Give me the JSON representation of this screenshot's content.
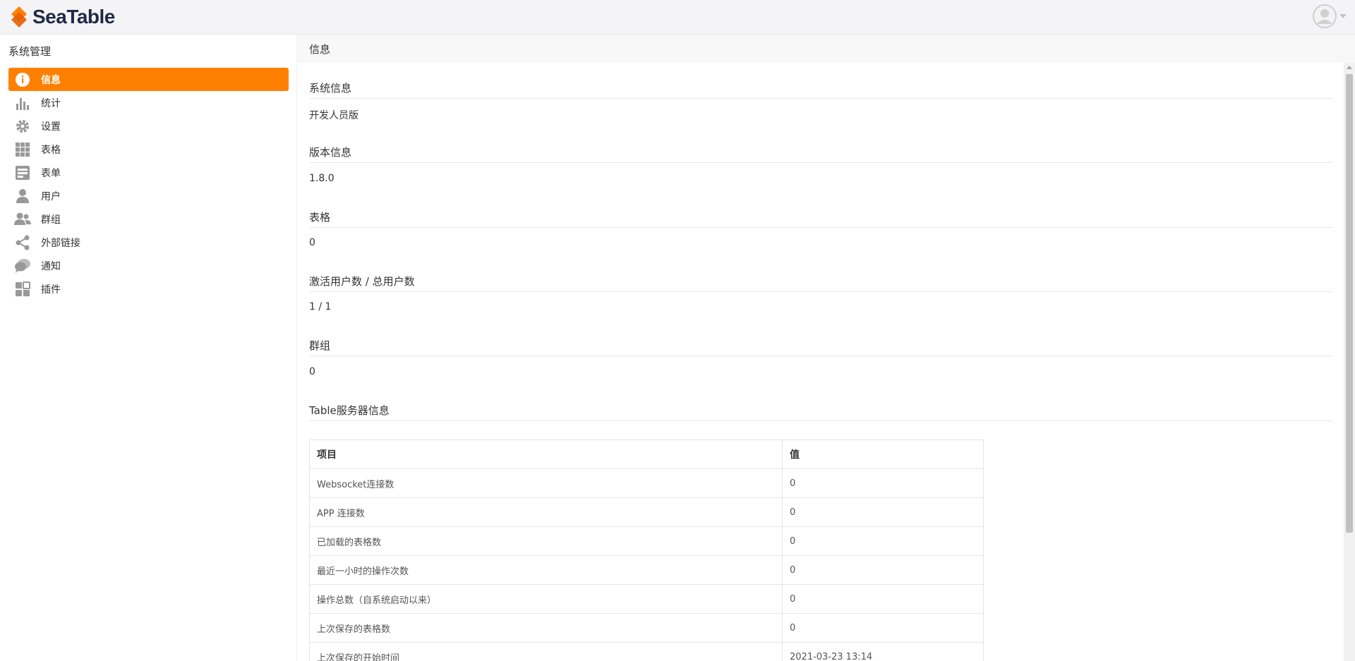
{
  "header": {
    "logo_text": "SeaTable",
    "brand_color": "#ff8000"
  },
  "sidebar": {
    "title": "系统管理",
    "items": [
      {
        "label": "信息",
        "icon": "info-icon",
        "active": true
      },
      {
        "label": "统计",
        "icon": "bar-chart-icon"
      },
      {
        "label": "设置",
        "icon": "gear-icon"
      },
      {
        "label": "表格",
        "icon": "grid-icon"
      },
      {
        "label": "表单",
        "icon": "form-icon"
      },
      {
        "label": "用户",
        "icon": "user-icon"
      },
      {
        "label": "群组",
        "icon": "group-icon"
      },
      {
        "label": "外部链接",
        "icon": "share-icon"
      },
      {
        "label": "通知",
        "icon": "chat-bubbles-icon"
      },
      {
        "label": "插件",
        "icon": "plugins-icon"
      }
    ]
  },
  "main": {
    "title": "信息",
    "sections": [
      {
        "title": "系统信息",
        "value": "开发人员版"
      },
      {
        "title": "版本信息",
        "value": "1.8.0"
      },
      {
        "title": "表格",
        "value": "0"
      },
      {
        "title": "激活用户数 / 总用户数",
        "value": "1 / 1"
      },
      {
        "title": "群组",
        "value": "0"
      },
      {
        "title": "Table服务器信息",
        "value": ""
      }
    ],
    "table": {
      "headers": [
        "项目",
        "值"
      ],
      "rows": [
        [
          "Websocket连接数",
          "0"
        ],
        [
          "APP 连接数",
          "0"
        ],
        [
          "已加载的表格数",
          "0"
        ],
        [
          "最近一小时的操作次数",
          "0"
        ],
        [
          "操作总数（自系统启动以来）",
          "0"
        ],
        [
          "上次保存的表格数",
          "0"
        ],
        [
          "上次保存的开始时间",
          "2021-03-23 13:14"
        ]
      ]
    }
  }
}
